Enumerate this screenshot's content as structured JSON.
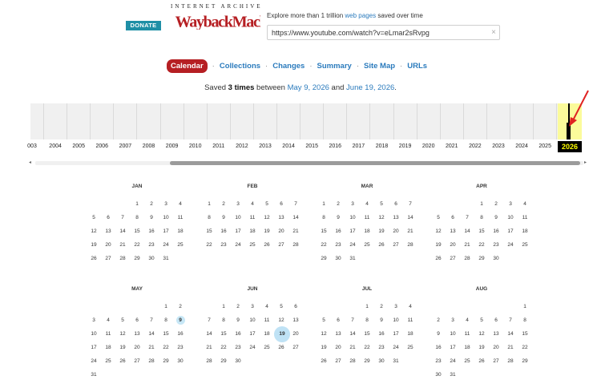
{
  "header": {
    "donate_label": "DONATE",
    "logo_top": "INTERNET ARCHIVE",
    "logo_main": "WaybackMachine",
    "tagline_prefix": "Explore more than 1 trillion ",
    "tagline_link": "web pages",
    "tagline_suffix": " saved over time",
    "url_value": "https://www.youtube.com/watch?v=eLmar2sRvpg",
    "clear_icon": "×"
  },
  "nav": {
    "items": [
      "Calendar",
      "Collections",
      "Changes",
      "Summary",
      "Site Map",
      "URLs"
    ],
    "separator": "·",
    "active": "Calendar"
  },
  "saved": {
    "prefix": "Saved ",
    "count": "3 times",
    "middle": " between ",
    "start": "May 9, 2026",
    "and": " and ",
    "end": "June 19, 2026",
    "period": "."
  },
  "timeline": {
    "years": [
      "003",
      "2004",
      "2005",
      "2006",
      "2007",
      "2008",
      "2009",
      "2010",
      "2011",
      "2012",
      "2013",
      "2014",
      "2015",
      "2016",
      "2017",
      "2018",
      "2019",
      "2020",
      "2021",
      "2022",
      "2023",
      "2024",
      "2025",
      "2026"
    ],
    "selected_year": "2026",
    "scroll_left": "◂",
    "scroll_right": "▸"
  },
  "colors": {
    "accent": "#b61f23",
    "link": "#2b7bbd",
    "donate": "#1f8fa6",
    "highlight": "#fbfb9b",
    "snapshot": "#c7e7f6"
  },
  "calendar": {
    "months": [
      {
        "name": "JAN",
        "offset": 3,
        "days": 31
      },
      {
        "name": "FEB",
        "offset": 0,
        "days": 28
      },
      {
        "name": "MAR",
        "offset": 0,
        "days": 31
      },
      {
        "name": "APR",
        "offset": 3,
        "days": 30
      },
      {
        "name": "MAY",
        "offset": 5,
        "days": 31,
        "snapshots": [
          9
        ]
      },
      {
        "name": "JUN",
        "offset": 1,
        "days": 30,
        "snapshots": [
          19
        ],
        "big": [
          19
        ]
      },
      {
        "name": "JUL",
        "offset": 3,
        "days": 31
      },
      {
        "name": "AUG",
        "offset": 6,
        "days": 31
      }
    ]
  }
}
